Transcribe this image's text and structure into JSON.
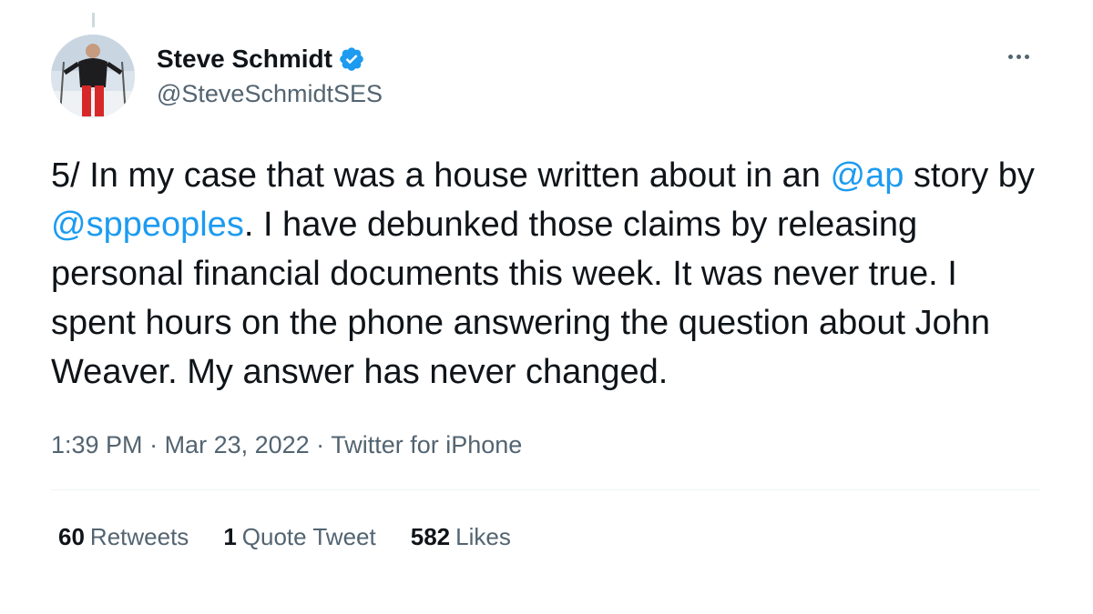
{
  "author": {
    "name": "Steve Schmidt",
    "handle": "@SteveSchmidtSES",
    "verified": true
  },
  "tweet": {
    "text_1": "5/ In my case that was a house written about in an ",
    "mention_1": "@ap",
    "text_2": " story by ",
    "mention_2": "@sppeoples",
    "text_3": ". I have debunked those claims by releasing personal financial documents this week. It was never true. I spent hours on the phone answering the question about John Weaver. My answer has never changed."
  },
  "meta": {
    "time": "1:39 PM",
    "separator": " · ",
    "date": "Mar 23, 2022",
    "source": "Twitter for iPhone"
  },
  "stats": {
    "retweets_count": "60",
    "retweets_label": "Retweets",
    "quotes_count": "1",
    "quotes_label": "Quote Tweet",
    "likes_count": "582",
    "likes_label": "Likes"
  },
  "icons": {
    "verified": "verified-badge-icon",
    "more": "more-options-icon"
  },
  "colors": {
    "link": "#1d9bf0",
    "secondary_text": "#536471",
    "primary_text": "#0f1419",
    "divider": "#eff3f4"
  }
}
